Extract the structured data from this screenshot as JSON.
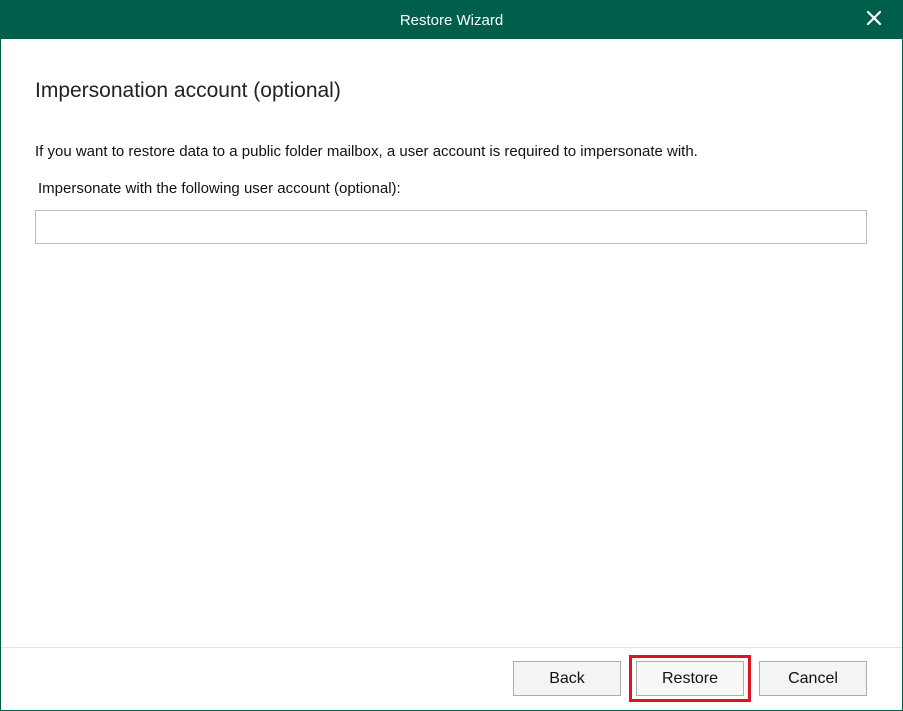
{
  "window": {
    "title": "Restore Wizard",
    "close_icon": "close-icon",
    "accent_color": "#005f4b"
  },
  "page": {
    "heading": "Impersonation account (optional)",
    "description": "If you want to restore data to a public folder mailbox, a user account is required to impersonate with.",
    "field_label": "Impersonate with the following user account (optional):",
    "field_value": "",
    "field_placeholder": ""
  },
  "footer": {
    "back_label": "Back",
    "restore_label": "Restore",
    "cancel_label": "Cancel",
    "highlight_color": "#e0141e"
  }
}
